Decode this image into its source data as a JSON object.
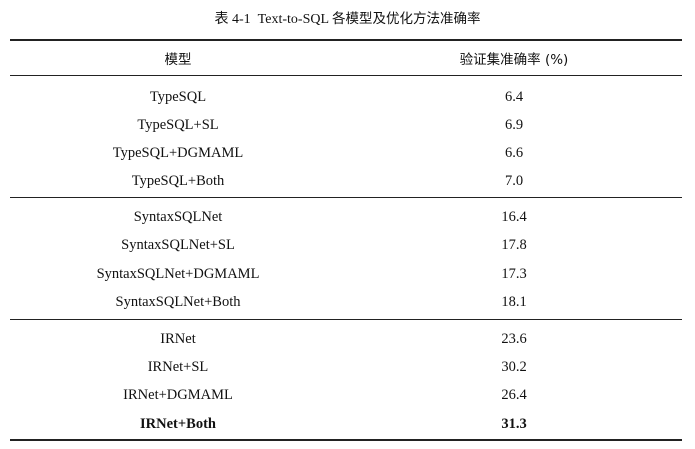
{
  "caption": {
    "label": "表 4-1",
    "title_en": "Text-to-SQL",
    "title_zh": "各模型及优化方法准确率"
  },
  "table": {
    "headers": {
      "model": "模型",
      "accuracy": "验证集准确率 (%)"
    },
    "groups": [
      {
        "rows": [
          {
            "model": "TypeSQL",
            "accuracy": "6.4"
          },
          {
            "model": "TypeSQL+SL",
            "accuracy": "6.9"
          },
          {
            "model": "TypeSQL+DGMAML",
            "accuracy": "6.6"
          },
          {
            "model": "TypeSQL+Both",
            "accuracy": "7.0"
          }
        ]
      },
      {
        "rows": [
          {
            "model": "SyntaxSQLNet",
            "accuracy": "16.4"
          },
          {
            "model": "SyntaxSQLNet+SL",
            "accuracy": "17.8"
          },
          {
            "model": "SyntaxSQLNet+DGMAML",
            "accuracy": "17.3"
          },
          {
            "model": "SyntaxSQLNet+Both",
            "accuracy": "18.1"
          }
        ]
      },
      {
        "rows": [
          {
            "model": "IRNet",
            "accuracy": "23.6"
          },
          {
            "model": "IRNet+SL",
            "accuracy": "30.2"
          },
          {
            "model": "IRNet+DGMAML",
            "accuracy": "26.4"
          },
          {
            "model": "IRNet+Both",
            "accuracy": "31.3",
            "bold": true
          }
        ]
      }
    ]
  }
}
